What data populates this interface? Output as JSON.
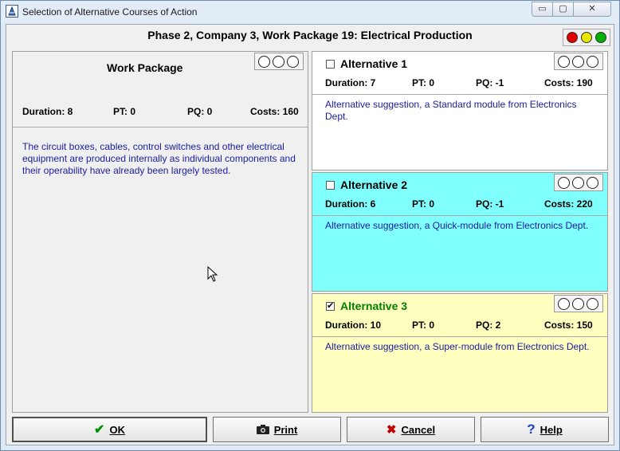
{
  "window": {
    "title": "Selection of Alternative Courses of Action"
  },
  "heading": "Phase 2, Company 3, Work Package 19: Electrical Production",
  "colors": {
    "red": "#e00000",
    "yellow": "#e8e800",
    "green": "#00b000",
    "alt2_bg": "#80ffff",
    "alt3_bg": "#ffffc0",
    "desc_text": "#1b1ba0",
    "alt3_title": "#008000"
  },
  "work_package": {
    "title": "Work Package",
    "duration": "Duration: 8",
    "pt": "PT: 0",
    "pq": "PQ: 0",
    "costs": "Costs: 160",
    "description": "The circuit boxes, cables, control switches and other electrical equipment are produced internally as individual components and their operability have already been largely tested."
  },
  "alternatives": [
    {
      "title": "Alternative 1",
      "checked": false,
      "duration": "Duration: 7",
      "pt": "PT: 0",
      "pq": "PQ: -1",
      "costs": "Costs: 190",
      "description": "Alternative suggestion, a Standard module from Electronics Dept."
    },
    {
      "title": "Alternative 2",
      "checked": false,
      "duration": "Duration: 6",
      "pt": "PT: 0",
      "pq": "PQ: -1",
      "costs": "Costs: 220",
      "description": "Alternative suggestion, a Quick-module from Electronics Dept."
    },
    {
      "title": "Alternative 3",
      "checked": true,
      "duration": "Duration: 10",
      "pt": "PT: 0",
      "pq": "PQ: 2",
      "costs": "Costs: 150",
      "description": "Alternative suggestion, a Super-module from Electronics Dept."
    }
  ],
  "buttons": {
    "ok": "OK",
    "print": "Print",
    "cancel": "Cancel",
    "help": "Help"
  },
  "icons": {
    "check": "✔",
    "camera": "📷",
    "cross": "✖",
    "question": "?",
    "minimize": "▭",
    "maximize": "▢",
    "close": "✕"
  }
}
